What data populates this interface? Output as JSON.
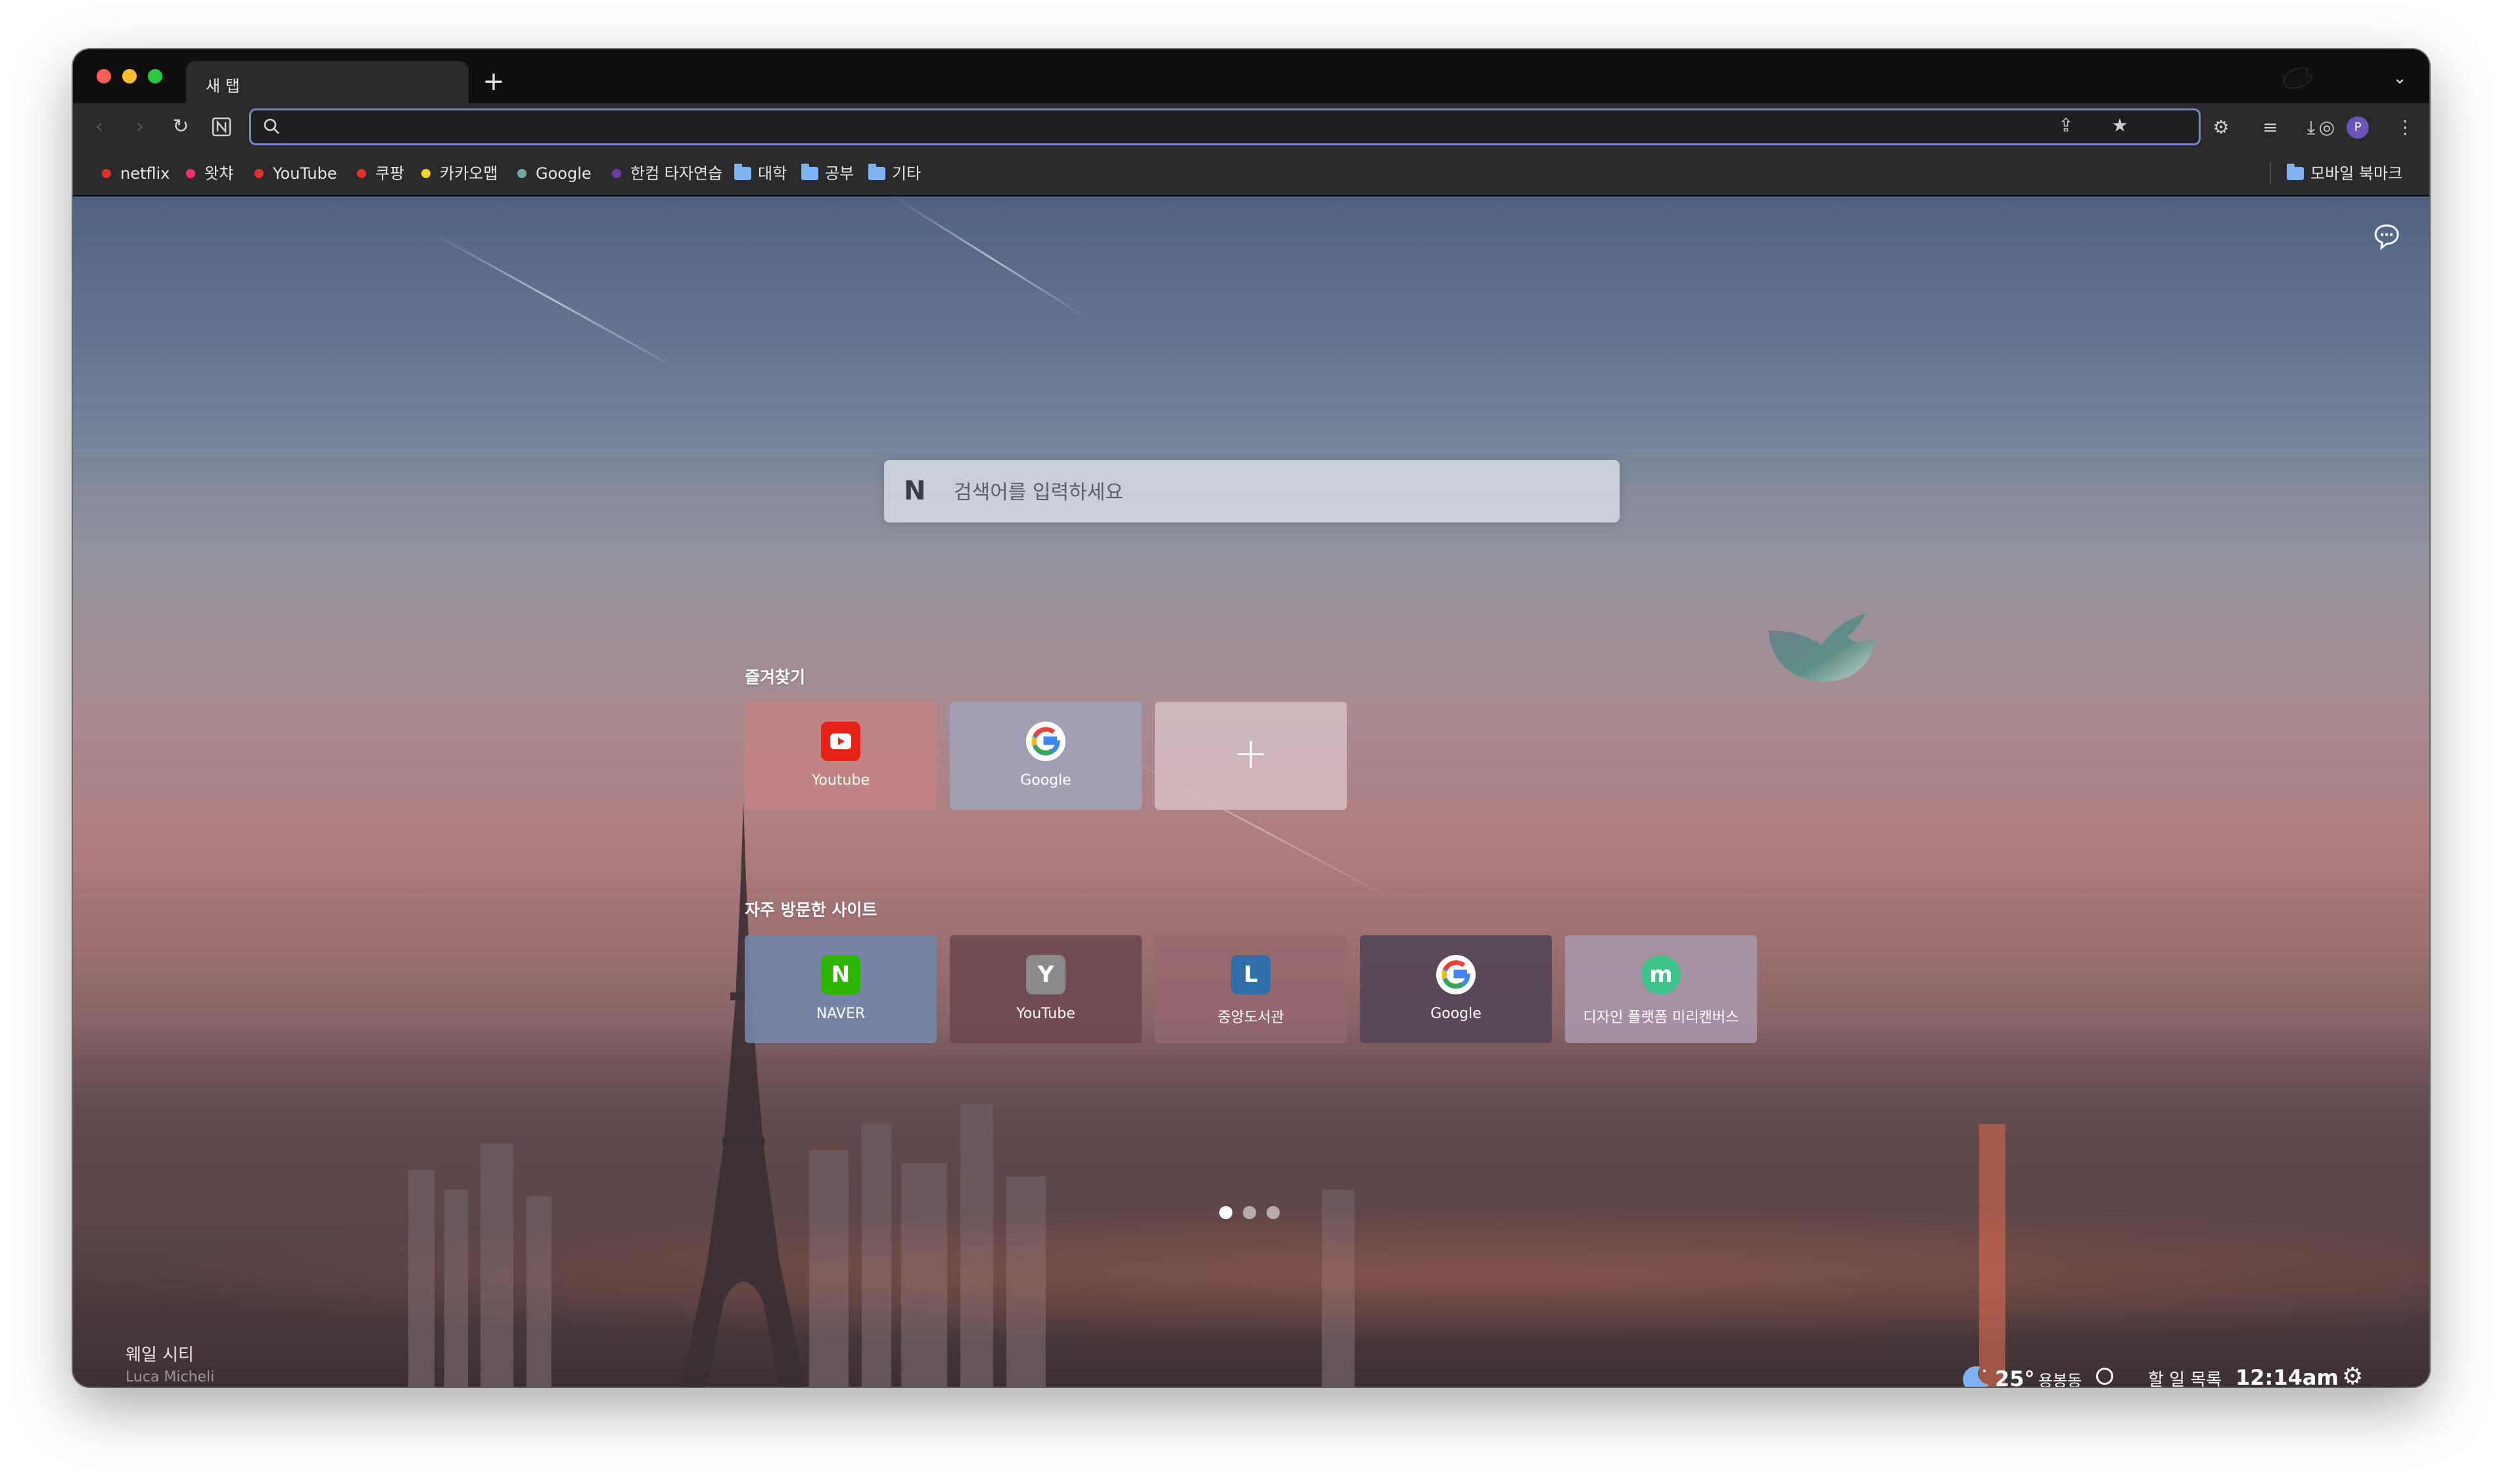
{
  "tab": {
    "title": "새 탭",
    "new_tab_symbol": "+"
  },
  "toolbar": {
    "address_value": "",
    "address_placeholder": "",
    "profile_initial": "P"
  },
  "bookmarks": [
    {
      "label": "netflix",
      "dot_color": "#e0312b"
    },
    {
      "label": "왓챠",
      "dot_color": "#ff2f6e"
    },
    {
      "label": "YouTube",
      "dot_color": "#e0312b"
    },
    {
      "label": "쿠팡",
      "dot_color": "#e0312b"
    },
    {
      "label": "카카오맵",
      "dot_color": "#f5d327"
    },
    {
      "label": "Google",
      "dot_color": "#6fa8a0"
    },
    {
      "label": "한컴 타자연습",
      "dot_color": "#6a3ea1"
    },
    {
      "label": "대학",
      "folder": true
    },
    {
      "label": "공부",
      "folder": true
    },
    {
      "label": "기타",
      "folder": true
    }
  ],
  "mobile_bookmarks": "모바일 북마크",
  "search": {
    "placeholder": "검색어를 입력하세요",
    "logo": "N"
  },
  "favorites": {
    "title": "즐겨찾기",
    "items": [
      {
        "label": "Youtube",
        "icon": "youtube-icon"
      },
      {
        "label": "Google",
        "icon": "google-icon"
      },
      {
        "label": "",
        "icon": "plus-icon",
        "symbol": "+"
      }
    ]
  },
  "frequent": {
    "title": "자주 방문한 사이트",
    "items": [
      {
        "label": "NAVER",
        "letter": "N",
        "color": "#2db400"
      },
      {
        "label": "YouTube",
        "letter": "Y",
        "color": "#8a8a8a"
      },
      {
        "label": "중앙도서관",
        "letter": "L",
        "color": "#2f6ea8"
      },
      {
        "label": "Google",
        "letter": "G",
        "color": "#ffffff"
      },
      {
        "label": "디자인 플랫폼 미리캔버스",
        "letter": "m",
        "color": "#3ec48a"
      }
    ]
  },
  "pager": {
    "count": 3,
    "active": 1
  },
  "background_credit": {
    "title": "웨일 시티",
    "author": "Luca Micheli"
  },
  "status": {
    "temperature": "25°",
    "location": "용봉동",
    "todo_label": "할 일 목록",
    "time": "12:14am"
  },
  "colors": {
    "accent": "#6f86c8",
    "toolbar": "#2a2a2c",
    "tabstrip": "#0f0f10"
  }
}
